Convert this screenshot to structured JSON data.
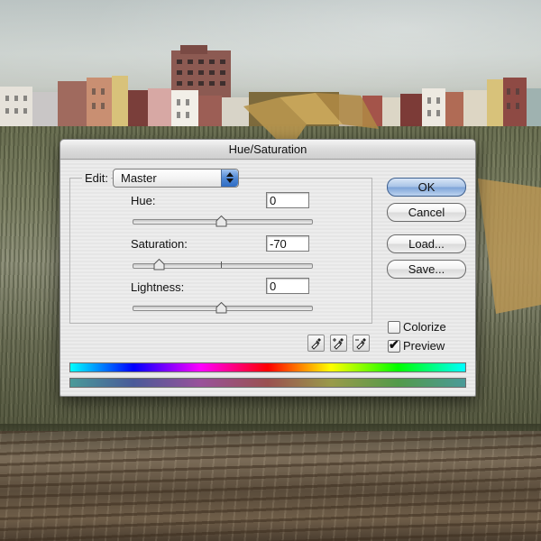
{
  "dialog": {
    "title": "Hue/Saturation",
    "edit_label": "Edit:",
    "edit_value": "Master",
    "hue": {
      "label": "Hue:",
      "value": "0",
      "slider_fraction": 0.5
    },
    "saturation": {
      "label": "Saturation:",
      "value": "-70",
      "slider_fraction": 0.15
    },
    "lightness": {
      "label": "Lightness:",
      "value": "0",
      "slider_fraction": 0.5
    },
    "buttons": {
      "ok": "OK",
      "cancel": "Cancel",
      "load": "Load...",
      "save": "Save..."
    },
    "colorize": {
      "label": "Colorize",
      "checked": false
    },
    "preview": {
      "label": "Preview",
      "checked": true
    },
    "eyedroppers": [
      "eyedropper-icon",
      "eyedropper-plus-icon",
      "eyedropper-minus-icon"
    ],
    "colors": {
      "default_button": "#7ea4d8",
      "dialog_bg": "#e8e8e8"
    }
  }
}
